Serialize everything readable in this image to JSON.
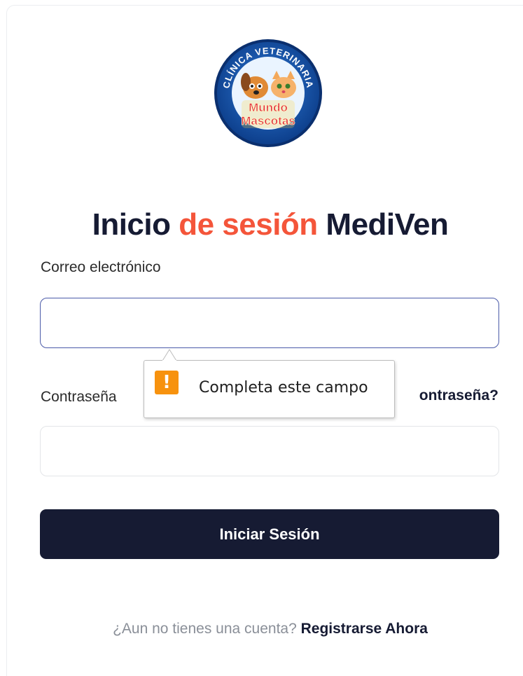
{
  "logo": {
    "top_text": "CLÍNICA VETERINARIA",
    "brand_line1": "Mundo",
    "brand_line2": "Mascotas"
  },
  "heading": {
    "part1": "Inicio ",
    "part2": "de sesión",
    "part3": " MediVen"
  },
  "form": {
    "email_label": "Correo electrónico",
    "email_value": "",
    "password_label": "Contraseña",
    "password_value": "",
    "forgot_visible": "ontraseña?",
    "submit_label": "Iniciar Sesión"
  },
  "validation_tooltip": {
    "icon": "warning-icon",
    "icon_glyph": "!",
    "message": "Completa este campo"
  },
  "register": {
    "prompt": "¿Aun no tienes una cuenta?",
    "link": "Registrarse Ahora"
  },
  "colors": {
    "primary": "#161b33",
    "accent": "#f4553a",
    "warning": "#f7920e",
    "focus_border": "#4a5aa8"
  }
}
